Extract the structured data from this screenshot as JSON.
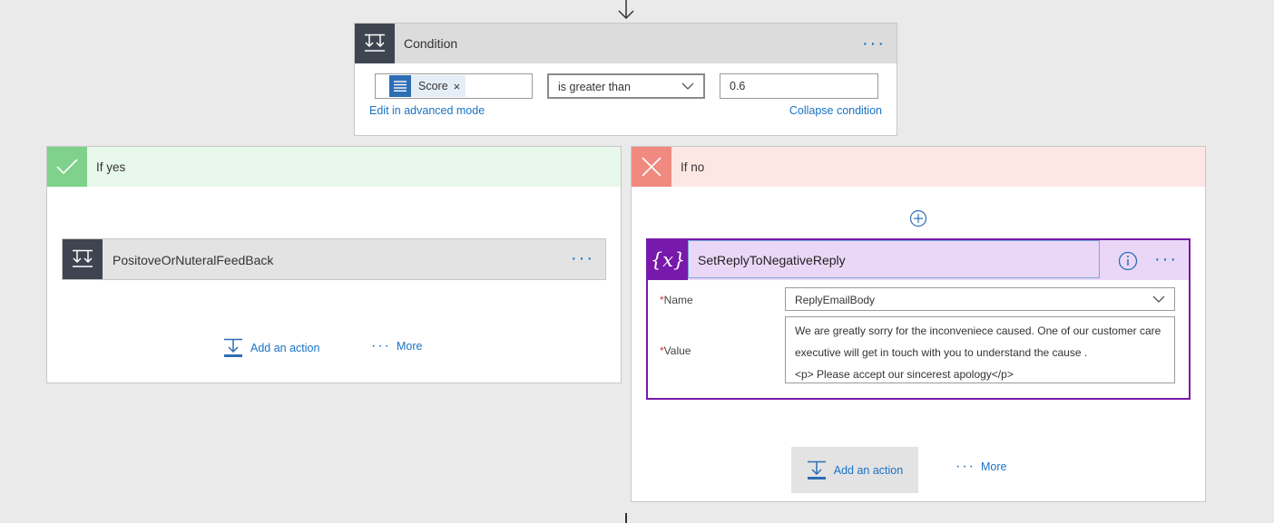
{
  "condition": {
    "title": "Condition",
    "token_label": "Score",
    "token_remove": "×",
    "operator": "is greater than",
    "value": "0.6",
    "edit_advanced": "Edit in advanced mode",
    "collapse": "Collapse condition"
  },
  "yes_branch": {
    "title": "If yes",
    "action_title": "PositoveOrNuteralFeedBack",
    "add_action": "Add an action",
    "more": "More"
  },
  "no_branch": {
    "title": "If no",
    "action_title": "SetReplyToNegativeReply",
    "name_label": "Name",
    "name_value": "ReplyEmailBody",
    "value_label": "Value",
    "value_lines": [
      "We are greatly sorry for the inconveniece caused. One of our customer care",
      "executive will get in touch with you to understand the cause .",
      "<p> Please accept our sincerest apology</p>"
    ],
    "required_mark": "*",
    "add_action": "Add an action",
    "more": "More"
  },
  "colors": {
    "accent_blue": "#0f6cbd",
    "yes_green": "#7fd18b",
    "no_red": "#f08a80",
    "variable_purple": "#7719aa"
  }
}
